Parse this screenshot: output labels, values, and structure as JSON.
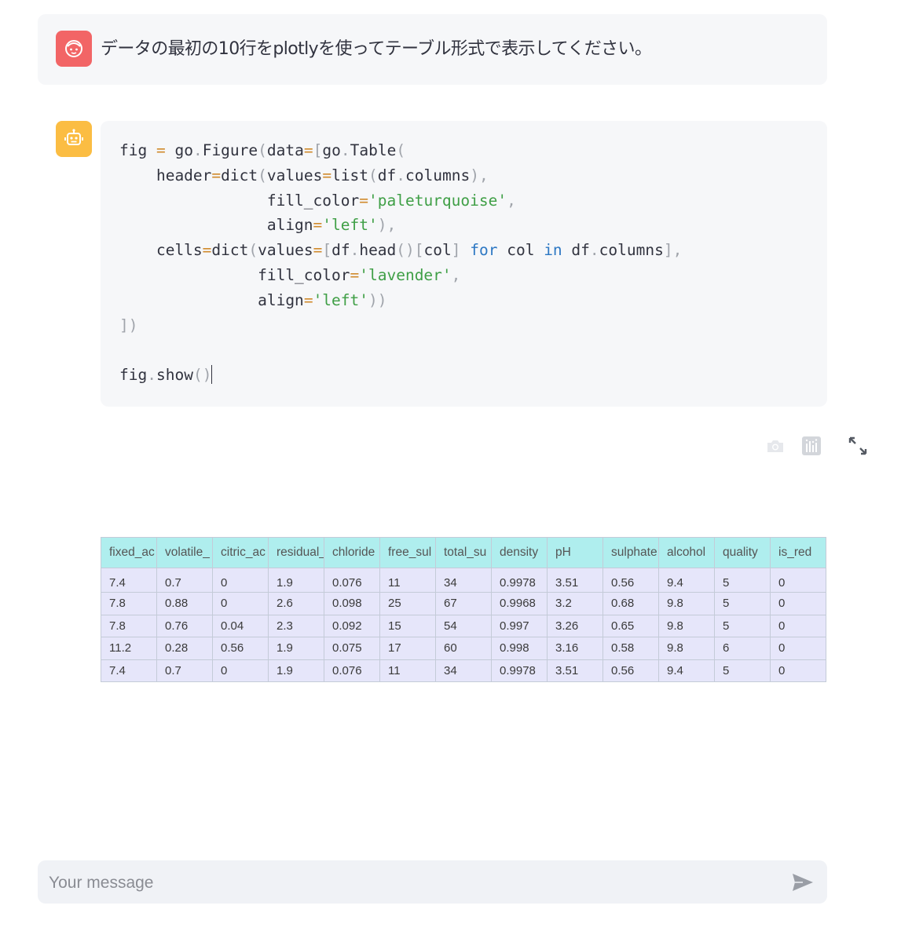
{
  "user_message": {
    "avatar_icon": "user-face-icon",
    "text": "データの最初の10行をplotlyを使ってテーブル形式で表示してください。"
  },
  "assistant": {
    "avatar_icon": "robot-icon",
    "code_lines": [
      [
        [
          "fig ",
          ""
        ],
        [
          "=",
          "o"
        ],
        [
          " go",
          ""
        ],
        [
          ".",
          "p"
        ],
        [
          "Figure",
          ""
        ],
        [
          "(",
          "p"
        ],
        [
          "data",
          ""
        ],
        [
          "=",
          "o"
        ],
        [
          "[",
          "p"
        ],
        [
          "go",
          ""
        ],
        [
          ".",
          "p"
        ],
        [
          "Table",
          ""
        ],
        [
          "(",
          "p"
        ]
      ],
      [
        [
          "    header",
          ""
        ],
        [
          "=",
          "o"
        ],
        [
          "dict",
          ""
        ],
        [
          "(",
          "p"
        ],
        [
          "values",
          ""
        ],
        [
          "=",
          "o"
        ],
        [
          "list",
          ""
        ],
        [
          "(",
          "p"
        ],
        [
          "df",
          ""
        ],
        [
          ".",
          "p"
        ],
        [
          "columns",
          ""
        ],
        [
          "),",
          "p"
        ]
      ],
      [
        [
          "                fill_color",
          ""
        ],
        [
          "=",
          "o"
        ],
        [
          "'paleturquoise'",
          "s"
        ],
        [
          ",",
          "p"
        ]
      ],
      [
        [
          "                align",
          ""
        ],
        [
          "=",
          "o"
        ],
        [
          "'left'",
          "s"
        ],
        [
          "),",
          "p"
        ]
      ],
      [
        [
          "    cells",
          ""
        ],
        [
          "=",
          "o"
        ],
        [
          "dict",
          ""
        ],
        [
          "(",
          "p"
        ],
        [
          "values",
          ""
        ],
        [
          "=",
          "o"
        ],
        [
          "[",
          "p"
        ],
        [
          "df",
          ""
        ],
        [
          ".",
          "p"
        ],
        [
          "head",
          ""
        ],
        [
          "()",
          "p"
        ],
        [
          "[",
          "p"
        ],
        [
          "col",
          ""
        ],
        [
          "]",
          "p"
        ],
        [
          " for",
          "k"
        ],
        [
          " col ",
          ""
        ],
        [
          "in",
          "k"
        ],
        [
          " df",
          ""
        ],
        [
          ".",
          "p"
        ],
        [
          "columns",
          ""
        ],
        [
          "],",
          "p"
        ]
      ],
      [
        [
          "               fill_color",
          ""
        ],
        [
          "=",
          "o"
        ],
        [
          "'lavender'",
          "s"
        ],
        [
          ",",
          "p"
        ]
      ],
      [
        [
          "               align",
          ""
        ],
        [
          "=",
          "o"
        ],
        [
          "'left'",
          "s"
        ],
        [
          "))",
          "p"
        ]
      ],
      [
        [
          "])",
          "p"
        ]
      ],
      [
        [
          "",
          ""
        ]
      ],
      [
        [
          "fig",
          ""
        ],
        [
          ".",
          "p"
        ],
        [
          "show",
          ""
        ],
        [
          "()",
          "p"
        ]
      ]
    ]
  },
  "modebar": {
    "buttons": [
      {
        "name": "camera-icon",
        "label": "Download plot as a png"
      },
      {
        "name": "plotly-logo-icon",
        "label": "Produced with Plotly"
      },
      {
        "name": "fullscreen-icon",
        "label": "Fullscreen"
      }
    ]
  },
  "table": {
    "header_fill": "#afeeee",
    "cell_fill": "#e6e6fa",
    "columns": [
      "fixed_ac",
      "volatile_",
      "citric_ac",
      "residual_",
      "chloride",
      "free_sul",
      "total_su",
      "density",
      "pH",
      "sulphate",
      "alcohol",
      "quality",
      "is_red"
    ],
    "rows": [
      [
        "7.4",
        "0.7",
        "0",
        "1.9",
        "0.076",
        "11",
        "34",
        "0.9978",
        "3.51",
        "0.56",
        "9.4",
        "5",
        "0"
      ],
      [
        "7.8",
        "0.88",
        "0",
        "2.6",
        "0.098",
        "25",
        "67",
        "0.9968",
        "3.2",
        "0.68",
        "9.8",
        "5",
        "0"
      ],
      [
        "7.8",
        "0.76",
        "0.04",
        "2.3",
        "0.092",
        "15",
        "54",
        "0.997",
        "3.26",
        "0.65",
        "9.8",
        "5",
        "0"
      ],
      [
        "11.2",
        "0.28",
        "0.56",
        "1.9",
        "0.075",
        "17",
        "60",
        "0.998",
        "3.16",
        "0.58",
        "9.8",
        "6",
        "0"
      ],
      [
        "7.4",
        "0.7",
        "0",
        "1.9",
        "0.076",
        "11",
        "34",
        "0.9978",
        "3.51",
        "0.56",
        "9.4",
        "5",
        "0"
      ]
    ]
  },
  "chat_input": {
    "placeholder": "Your message",
    "value": "",
    "send_icon": "send-icon"
  }
}
